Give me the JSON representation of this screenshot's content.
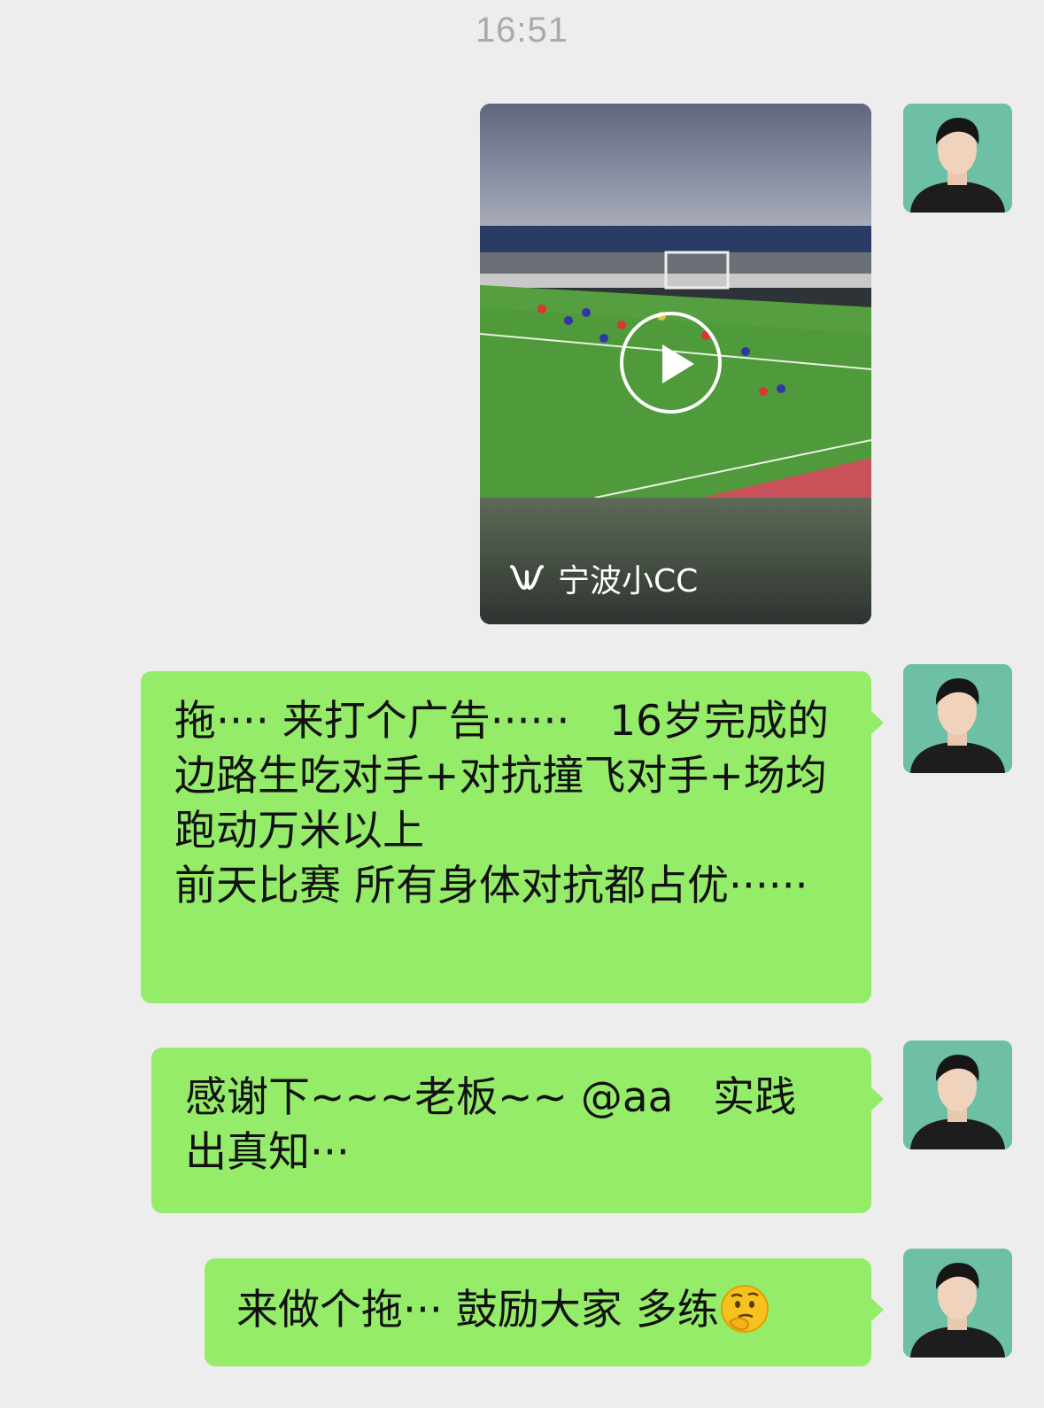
{
  "timestamp": "16:51",
  "video": {
    "channel_icon": "channels-icon",
    "channel_name": "宁波小CC"
  },
  "messages": [
    {
      "text": "拖···· 来打个广告······   16岁完成的边路生吃对手+对抗撞飞对手+场均跑动万米以上\n前天比赛 所有身体对抗都占优······"
    },
    {
      "text": "感谢下~~~老板~~ @aa   实践出真知···"
    },
    {
      "text": "来做个拖··· 鼓励大家 多练",
      "emoji": "thinking-face-emoji"
    }
  ],
  "colors": {
    "background": "#ededed",
    "bubble": "#95ec69",
    "avatar_bg": "#6dbfa6"
  }
}
